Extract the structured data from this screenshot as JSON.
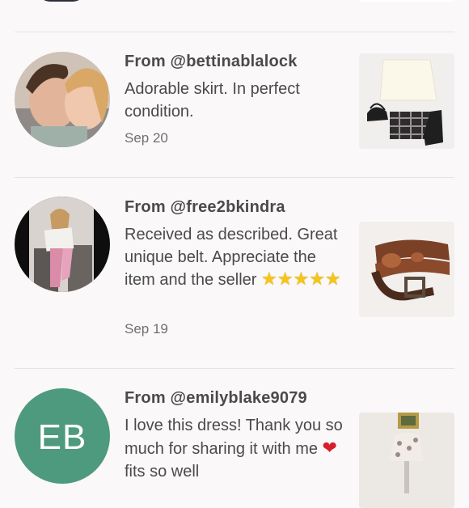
{
  "reviews": [
    {
      "from": "From @bettinablalock",
      "text": "Adorable skirt. In perfect condition.",
      "date": "Sep 20"
    },
    {
      "from": "From @free2bkindra",
      "text": "Received as described. Great unique belt. Appreciate the item and the seller",
      "stars": 5,
      "date": "Sep 19"
    },
    {
      "from": "From @emilyblake9079",
      "text_before": "I love this dress! Thank you so much for sharing it with me ",
      "text_after": " fits so well",
      "avatar_initials": "EB",
      "avatar_color": "#4e9a7e"
    }
  ],
  "colors": {
    "star": "#f5c51b",
    "heart": "#d81e2b",
    "divider": "#e6e3e4"
  }
}
